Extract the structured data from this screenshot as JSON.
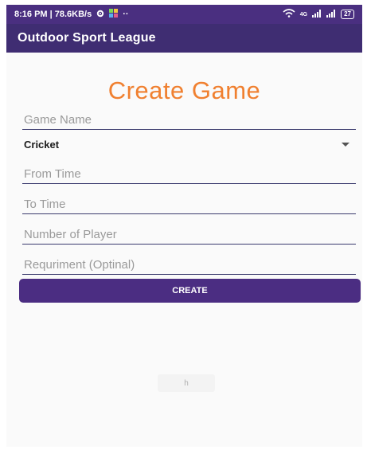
{
  "status_bar": {
    "left_text": "8:16 PM | 78.6KB/s",
    "settings_icon": "gear-icon",
    "app_icon": "app-grid-icon",
    "more_text": "··",
    "network_label": "4G",
    "battery": "27"
  },
  "app_bar": {
    "title": "Outdoor Sport League"
  },
  "form": {
    "title": "Create Game",
    "game_name_placeholder": "Game Name",
    "sport_selected": "Cricket",
    "from_time_placeholder": "From Time",
    "to_time_placeholder": "To Time",
    "players_placeholder": "Number of Player",
    "requirement_placeholder": "Requriment (Optinal)",
    "create_label": "CREATE"
  },
  "toast": {
    "text": "h"
  },
  "colors": {
    "status_bar_bg": "#4a2f80",
    "app_bar_bg": "#3f2d72",
    "title_color": "#f08030",
    "button_bg": "#4b2d82"
  }
}
